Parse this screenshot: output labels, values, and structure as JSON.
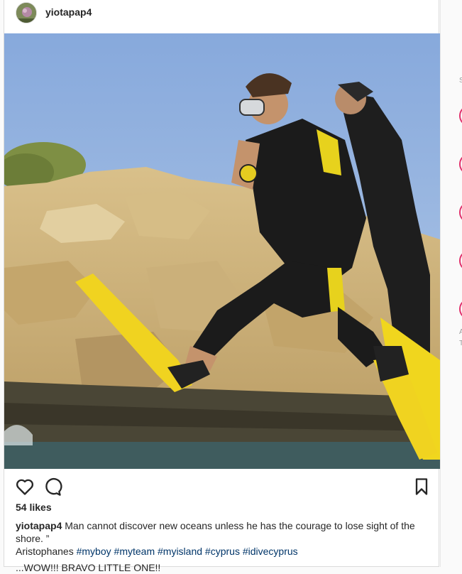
{
  "post": {
    "username": "yiotapap4",
    "likes_text": "54 likes",
    "caption": {
      "username": "yiotapap4",
      "text": "Man cannot discover new oceans unless he has the courage to lose sight of the shore. ”",
      "author": "Aristophanes",
      "hashtags": [
        "#myboy",
        "#myteam",
        "#myisland",
        "#cyprus",
        "#idivecyprus"
      ]
    },
    "comment_preview": "...WOW!!! BRAVO LITTLE ONE!!"
  },
  "sidebar": {
    "letters": [
      "S",
      "A",
      "T"
    ]
  },
  "icons": {
    "like": "heart-icon",
    "comment": "comment-icon",
    "save": "bookmark-icon"
  },
  "colors": {
    "text": "#262626",
    "hashtag": "#003569",
    "border": "#dbdbdb",
    "story_ring": "#e1306c"
  }
}
